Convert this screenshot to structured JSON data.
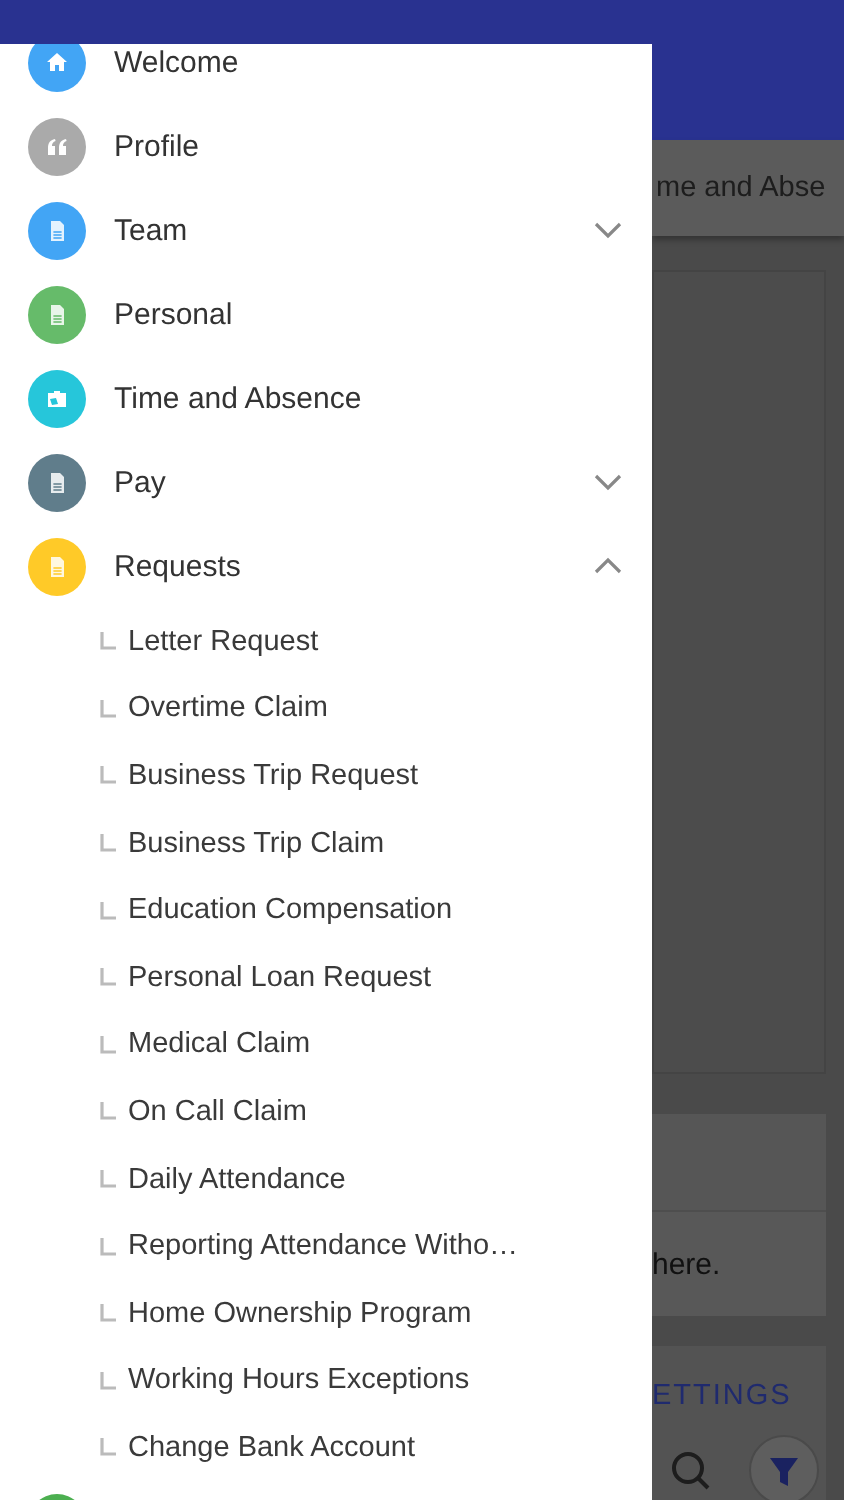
{
  "background": {
    "tab_fragment": "me and Abse",
    "message_fragment": "here.",
    "settings_fragment": "ETTINGS"
  },
  "menu": [
    {
      "label": "Welcome",
      "kind": "home",
      "color": "#42a5f5"
    },
    {
      "label": "Profile",
      "kind": "quote",
      "color": "#aaaaaa"
    },
    {
      "label": "Team",
      "kind": "document",
      "color": "#42a5f5",
      "expanded": false
    },
    {
      "label": "Personal",
      "kind": "document",
      "color": "#66bb6a"
    },
    {
      "label": "Time and Absence",
      "kind": "briefcase",
      "color": "#26c6da"
    },
    {
      "label": "Pay",
      "kind": "document",
      "color": "#607d8b",
      "expanded": false
    },
    {
      "label": "Requests",
      "kind": "document",
      "color": "#ffca28",
      "expanded": true,
      "children": [
        {
          "label": "Letter Request"
        },
        {
          "label": "Overtime Claim"
        },
        {
          "label": "Business Trip Request"
        },
        {
          "label": "Business Trip Claim"
        },
        {
          "label": "Education Compensation"
        },
        {
          "label": "Personal Loan Request"
        },
        {
          "label": "Medical Claim"
        },
        {
          "label": "On Call Claim"
        },
        {
          "label": "Daily Attendance"
        },
        {
          "label": "Reporting Attendance Witho…"
        },
        {
          "label": "Home Ownership Program"
        },
        {
          "label": "Working Hours Exceptions"
        },
        {
          "label": "Change Bank Account"
        }
      ]
    },
    {
      "kind": "document",
      "color": "#4caf50"
    }
  ]
}
